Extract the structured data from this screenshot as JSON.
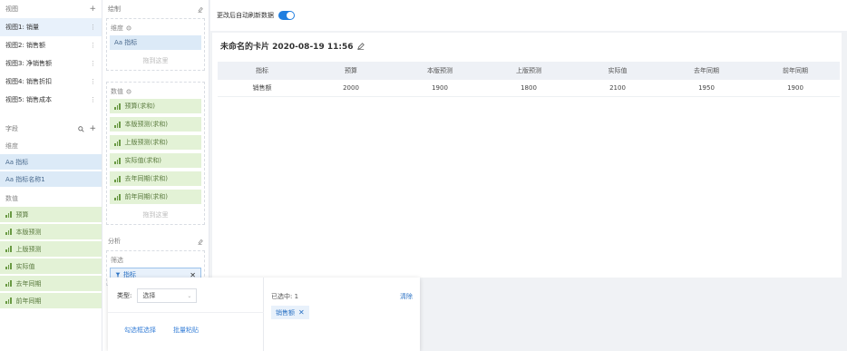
{
  "left": {
    "views_title": "视图",
    "views": [
      "视图1: 销量",
      "视图2: 销售额",
      "视图3: 净销售额",
      "视图4: 销售折扣",
      "视图5: 销售成本"
    ],
    "fields_title": "字段",
    "dimension_title": "维度",
    "dimensions": [
      "Aa 指标",
      "Aa 指标名称1"
    ],
    "measure_title": "数值",
    "measures": [
      "预算",
      "本版预测",
      "上版预测",
      "实际值",
      "去年同期",
      "前年同期"
    ]
  },
  "mid": {
    "title": "绘制",
    "dimension_label": "维度",
    "dimension_chip": "Aa 指标",
    "drop_hint": "拖到这里",
    "measure_label": "数值",
    "measure_chips": [
      "预算(求和)",
      "本版预测(求和)",
      "上版预测(求和)",
      "实际值(求和)",
      "去年同期(求和)",
      "前年同期(求和)"
    ],
    "analysis_title": "分析",
    "filter_label": "筛选",
    "filter_chip": "指标"
  },
  "main": {
    "auto_refresh": "更改后自动刷新数据",
    "card_title": "未命名的卡片 2020-08-19 11:56",
    "table": {
      "headers": [
        "指标",
        "预算",
        "本版预测",
        "上版预测",
        "实际值",
        "去年同期",
        "前年同期"
      ],
      "rows": [
        [
          "销售额",
          "2000",
          "1900",
          "1800",
          "2100",
          "1950",
          "1900"
        ]
      ]
    }
  },
  "popup": {
    "type_label": "类型:",
    "type_value": "选择",
    "link_a": "勾选框选择",
    "link_b": "批量粘贴",
    "selected_count": "已选中: 1",
    "clear": "清除",
    "selected_item": "销售额"
  },
  "colors": {
    "accent": "#1f7ee0",
    "dimension_bg": "#dceaf7",
    "measure_bg": "#e3f2d6"
  }
}
